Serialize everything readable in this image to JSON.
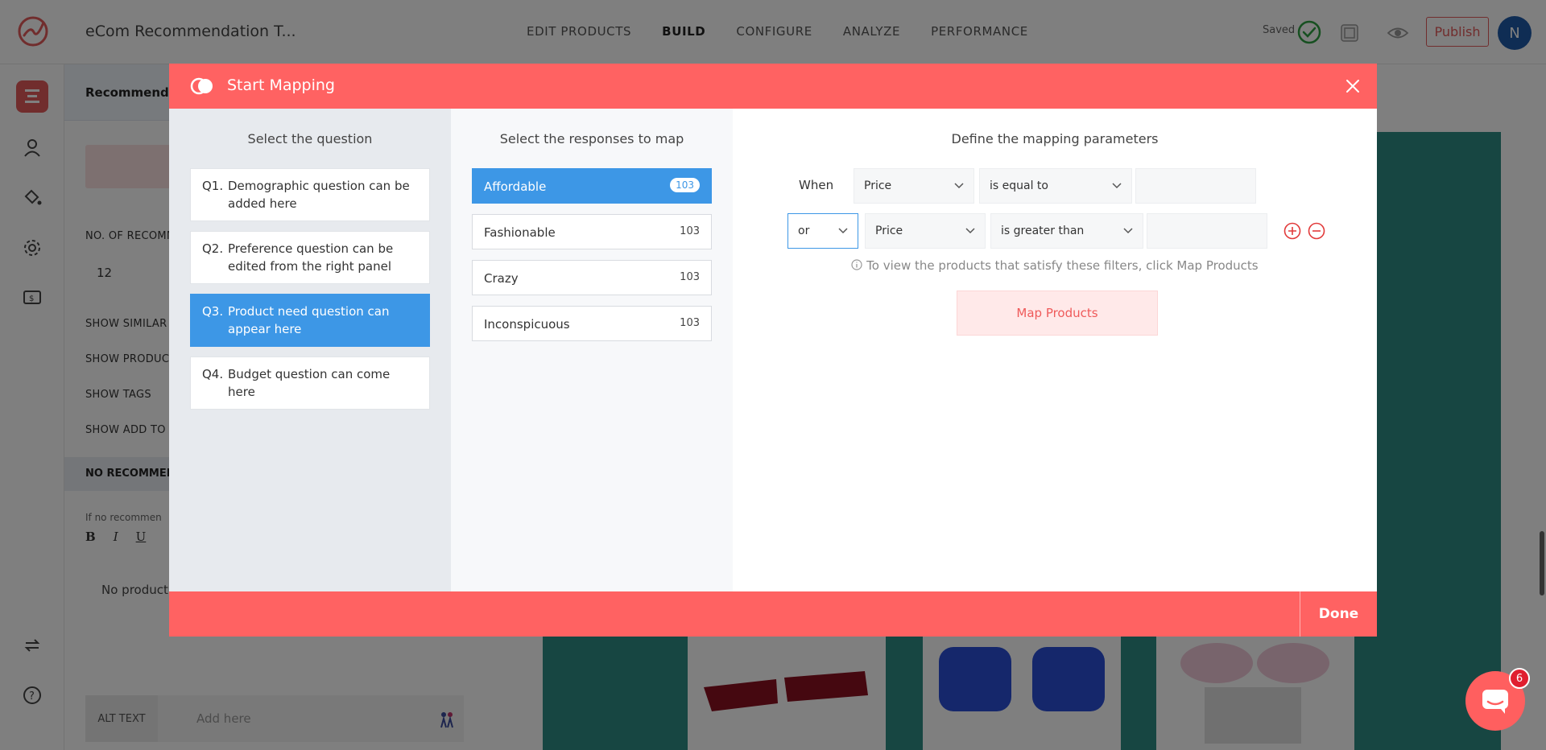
{
  "app": {
    "title": "eCom Recommendation T...",
    "nav": [
      {
        "label": "EDIT PRODUCTS",
        "active": false
      },
      {
        "label": "BUILD",
        "active": true
      },
      {
        "label": "CONFIGURE",
        "active": false
      },
      {
        "label": "ANALYZE",
        "active": false
      },
      {
        "label": "PERFORMANCE",
        "active": false
      }
    ],
    "saved_label": "Saved",
    "publish_label": "Publish",
    "avatar_initial": "N"
  },
  "background_panel": {
    "header": "Recommenda",
    "no_of_recommendations_label": "NO. OF RECOMM",
    "no_of_recommendations_value": "12",
    "show_similar_label": "SHOW SIMILAR I",
    "show_product_label": "SHOW PRODUCT",
    "show_tags_label": "SHOW TAGS",
    "show_add_label": "SHOW ADD TO C",
    "no_rec_header": "NO RECOMMEN",
    "no_rec_hint": "If no recommen",
    "toolbar": [
      "B",
      "I",
      "U"
    ],
    "editor_text": "No product",
    "alt_text_label": "ALT TEXT",
    "alt_text_placeholder": "Add here"
  },
  "modal": {
    "title": "Start Mapping",
    "questions_title": "Select the question",
    "questions": [
      {
        "num": "Q1.",
        "text": "Demographic question can be added here",
        "selected": false
      },
      {
        "num": "Q2.",
        "text": "Preference question can be edited from the right panel",
        "selected": false
      },
      {
        "num": "Q3.",
        "text": "Product need question can appear here",
        "selected": true
      },
      {
        "num": "Q4.",
        "text": "Budget question can come here",
        "selected": false
      }
    ],
    "responses_title": "Select the responses to map",
    "responses": [
      {
        "label": "Affordable",
        "count": "103",
        "selected": true
      },
      {
        "label": "Fashionable",
        "count": "103",
        "selected": false
      },
      {
        "label": "Crazy",
        "count": "103",
        "selected": false
      },
      {
        "label": "Inconspicuous",
        "count": "103",
        "selected": false
      }
    ],
    "params_title": "Define the mapping parameters",
    "rule1": {
      "prefix": "When",
      "field": "Price",
      "operator": "is equal to",
      "value": ""
    },
    "rule2": {
      "connector": "or",
      "field": "Price",
      "operator": "is greater than",
      "value": ""
    },
    "info_note": "To view the products that satisfy these filters, click Map Products",
    "map_button": "Map Products",
    "done_button": "Done"
  },
  "chat": {
    "badge": "6"
  },
  "colors": {
    "brand": "#ff6262",
    "selected": "#3d97e6",
    "preview": "#2f8c84"
  }
}
